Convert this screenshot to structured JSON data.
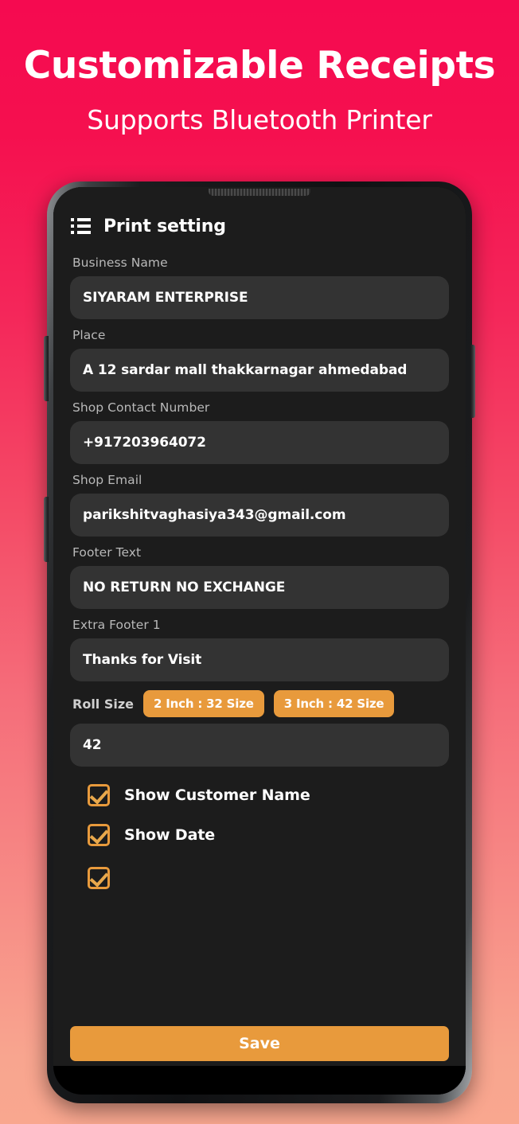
{
  "promo": {
    "title": "Customizable Receipts",
    "subtitle": "Supports Bluetooth Printer",
    "title_color": "#FFFFFF",
    "bg_top_color": "#F50A50",
    "bg_bottom_color": "#F9A78F"
  },
  "app": {
    "appbar": {
      "menu_icon": "list-bullet-icon",
      "title": "Print setting"
    },
    "accent_color": "#E89A3C",
    "screen_bg_color": "#1C1C1C",
    "input_bg_color": "#333333",
    "fields": [
      {
        "label": "Business Name",
        "value": "SIYARAM ENTERPRISE"
      },
      {
        "label": "Place",
        "value": "A 12 sardar mall thakkarnagar ahmedabad"
      },
      {
        "label": "Shop Contact Number",
        "value": "+917203964072"
      },
      {
        "label": "Shop Email",
        "value": "parikshitvaghasiya343@gmail.com"
      },
      {
        "label": "Footer Text",
        "value": "NO RETURN NO EXCHANGE"
      },
      {
        "label": "Extra Footer 1",
        "value": "Thanks for Visit"
      }
    ],
    "roll_size": {
      "label": "Roll Size",
      "options": [
        {
          "label": "2 Inch : 32 Size"
        },
        {
          "label": "3 Inch : 42 Size"
        }
      ],
      "value": "42"
    },
    "checkboxes": [
      {
        "label": "Show Customer Name",
        "checked": true
      },
      {
        "label": "Show Date",
        "checked": true
      }
    ],
    "save_button": {
      "label": "Save"
    }
  }
}
